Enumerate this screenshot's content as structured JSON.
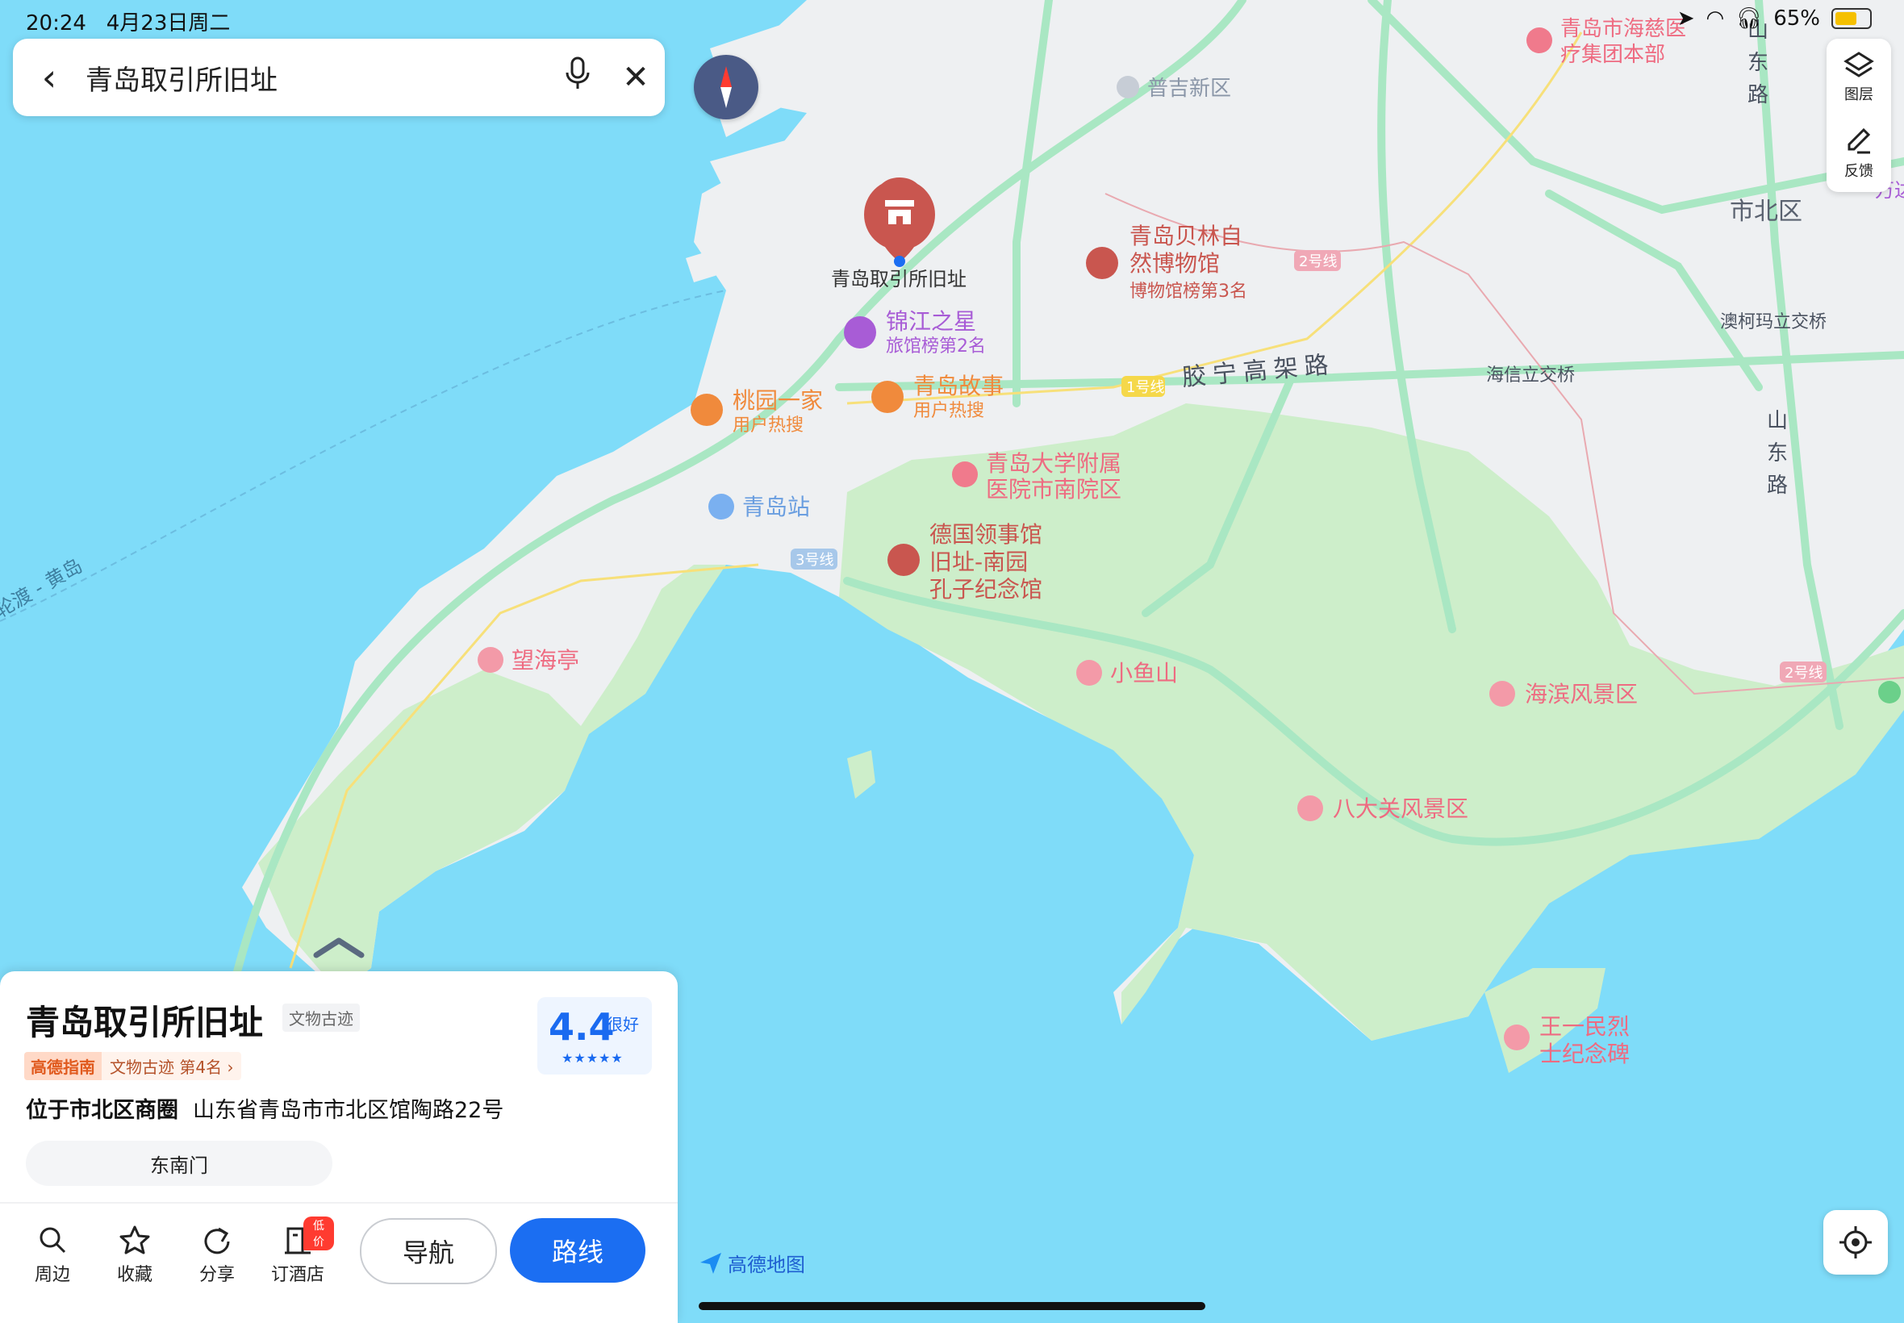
{
  "status_bar": {
    "time": "20:24",
    "date": "4月23日周二",
    "battery": "65%",
    "battery_level": 0.65
  },
  "search": {
    "query": "青岛取引所旧址"
  },
  "side_tools": [
    {
      "label": "图层",
      "icon": "layers-icon"
    },
    {
      "label": "反馈",
      "icon": "edit-icon"
    }
  ],
  "map": {
    "selected_marker_label": "青岛取引所旧址",
    "pois": [
      {
        "name": "普吉新区",
        "sub": ""
      },
      {
        "name": "青岛市海慈医",
        "sub": "疗集团本部"
      },
      {
        "name": "青岛贝林自",
        "sub": "然博物馆",
        "rank": "博物馆榜第3名"
      },
      {
        "name": "锦江之星",
        "sub": "旅馆榜第2名"
      },
      {
        "name": "桃园一家",
        "sub": "用户热搜"
      },
      {
        "name": "青岛故事",
        "sub": "用户热搜"
      },
      {
        "name": "青岛大学附属",
        "sub": "医院市南院区"
      },
      {
        "name": "青岛站",
        "sub": ""
      },
      {
        "name": "德国领事馆",
        "sub": "旧址-南园",
        "sub2": "孔子纪念馆"
      },
      {
        "name": "望海亭",
        "sub": ""
      },
      {
        "name": "小鱼山",
        "sub": ""
      },
      {
        "name": "海滨风景区",
        "sub": ""
      },
      {
        "name": "八大关风景区",
        "sub": ""
      },
      {
        "name": "王一民烈",
        "sub": "士纪念碑"
      }
    ],
    "areas": [
      "市北区"
    ],
    "roads": [
      "胶宁高架路",
      "海信立交桥",
      "澳柯玛立交桥",
      "山东路",
      "山东路"
    ],
    "road_vertical_top": [
      "山",
      "东",
      "路"
    ],
    "road_vertical_right": [
      "山",
      "东",
      "路"
    ],
    "metro": [
      "1号线",
      "2号线",
      "3号线",
      "2号线"
    ],
    "ferry_label": "轮渡 - 黄岛",
    "edge_fragment": "万达",
    "colors": {
      "sea": "#7fdcf9",
      "land": "#eef0f2",
      "park": "#cdeeca",
      "road": "#a9e7c3",
      "poi_red": "#e8697c",
      "marker": "#c9564f"
    }
  },
  "poi_panel": {
    "title": "青岛取引所旧址",
    "category_tag": "文物古迹",
    "rating_score": "4.4",
    "rating_label": "很好",
    "rating_stars": "★★★★★",
    "guide_brand": "高德指南",
    "guide_rank": "文物古迹  第4名 ›",
    "district": "位于市北区商圈",
    "address": "山东省青岛市市北区馆陶路22号",
    "gate": "东南门",
    "actions": [
      {
        "label": "周边",
        "icon": "search-icon"
      },
      {
        "label": "收藏",
        "icon": "star-icon"
      },
      {
        "label": "分享",
        "icon": "share-icon"
      },
      {
        "label": "订酒店",
        "icon": "hotel-icon",
        "badge": "低价"
      }
    ],
    "btn_nav": "导航",
    "btn_route": "路线"
  },
  "brand_logo": "高德地图"
}
